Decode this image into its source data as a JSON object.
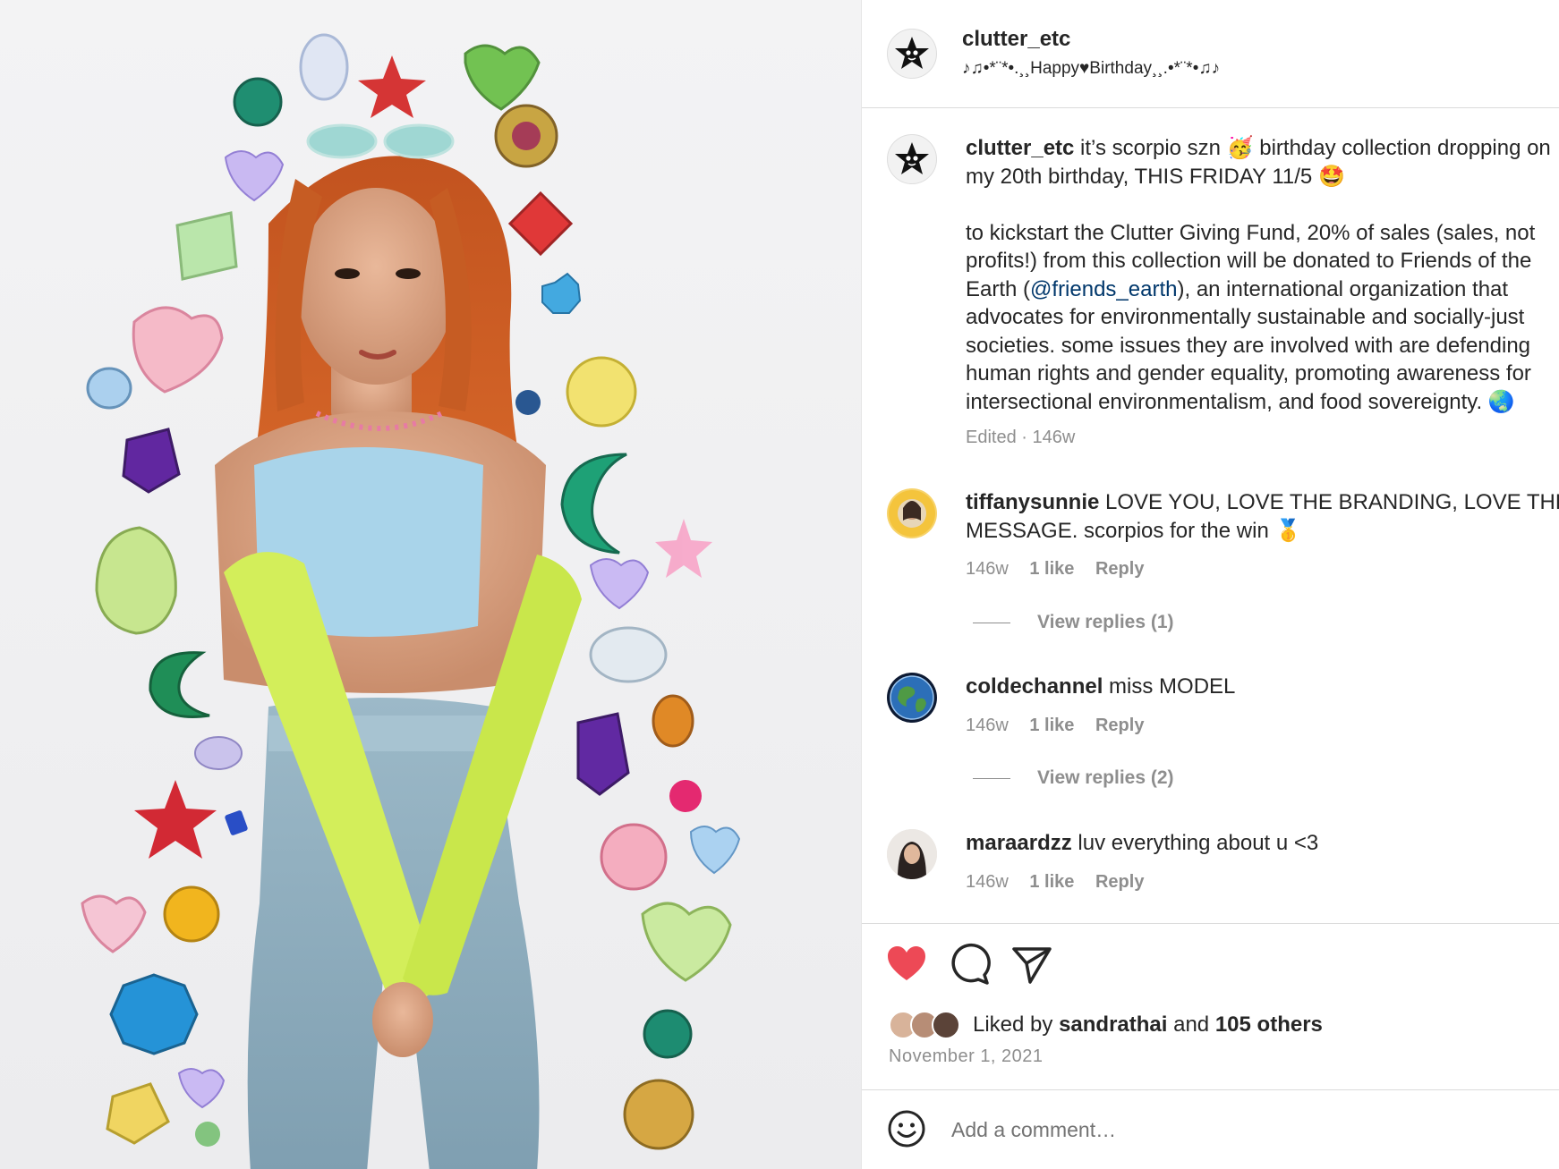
{
  "post": {
    "image_alt": "Model with orange hair wearing blue top, lime arm sleeves and jeans surrounded by colorful gem stickers"
  },
  "header": {
    "username": "clutter_etc",
    "subtitle": "♪♫•*¨*•.¸¸Happy♥Birthday¸¸.•*¨*•♫♪"
  },
  "caption": {
    "username": "clutter_etc",
    "line1": " it’s scorpio szn 🥳 birthday collection dropping on",
    "line2": "my 20th birthday, THIS FRIDAY 11/5 🤩",
    "line3": "to kickstart the Clutter Giving Fund, 20% of sales (sales, not",
    "line4": "profits!) from this collection will be donated to Friends of the",
    "line5_pre": "Earth (",
    "mention": "@friends_earth",
    "line5_post": "), an international organization that",
    "line6": "advocates for environmentally sustainable and socially-just",
    "line7": "societies. some issues they are involved with are defending",
    "line8": "human rights and gender equality, promoting awareness for",
    "line9": "intersectional environmentalism, and food sovereignty. 🌏",
    "edited": "Edited · 146w"
  },
  "comments": [
    {
      "username": "tiffanysunnie",
      "text_line1": " LOVE YOU, LOVE THE BRANDING, LOVE THE",
      "text_line2": "MESSAGE. scorpios for the win 🥇",
      "time": "146w",
      "likes": "1 like",
      "reply": "Reply",
      "view_replies": "View replies (1)"
    },
    {
      "username": "coldechannel",
      "text_line1": " miss MODEL",
      "time": "146w",
      "likes": "1 like",
      "reply": "Reply",
      "view_replies": "View replies (2)"
    },
    {
      "username": "maraardzz",
      "text_line1": " luv everything about u <3",
      "time": "146w",
      "likes": "1 like",
      "reply": "Reply"
    }
  ],
  "actions": {
    "like_icon": "heart-filled-icon",
    "comment_icon": "speech-bubble-icon",
    "share_icon": "paper-plane-icon",
    "liked_state_color": "#ed4956"
  },
  "likes": {
    "prefix": "Liked by ",
    "user": "sandrathai",
    "middle": " and ",
    "others": "105 others"
  },
  "date": "November 1, 2021",
  "add_comment": {
    "placeholder": "Add a comment…",
    "emoji_icon": "smiley-icon"
  }
}
